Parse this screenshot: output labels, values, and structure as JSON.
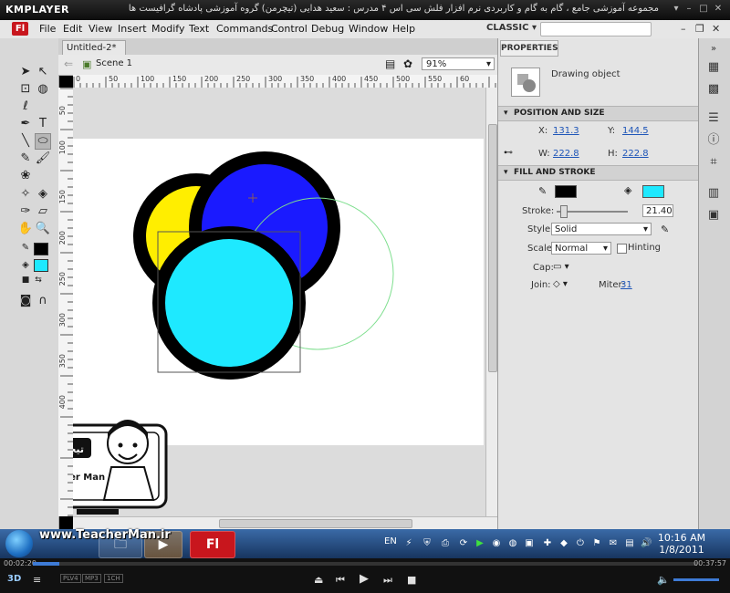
{
  "player": {
    "logo": "KMPLAYER",
    "title": "مجموعه آموزشی جامع ، گام به گام و کاربردی نرم افزار فلش سی اس ۴ مدرس : سعید هدایی (تیچرمن) گروه آموزشی پادشاه گرافیست ها",
    "elapsed": "00:02:20",
    "total": "00:37:57",
    "progress_fraction": 0.04,
    "badges": [
      "PLV4",
      "MP3",
      "1CH"
    ]
  },
  "menu": {
    "app_logo": "Fl",
    "items": [
      "File",
      "Edit",
      "View",
      "Insert",
      "Modify",
      "Text",
      "Commands",
      "Control",
      "Debug",
      "Window",
      "Help"
    ],
    "workspace": "CLASSIC"
  },
  "document": {
    "tab": "Untitled-2*",
    "scene": "Scene 1",
    "zoom": "91%"
  },
  "ruler": {
    "top_labels": [
      "0",
      "50",
      "100",
      "150",
      "200",
      "250",
      "300",
      "350",
      "400",
      "450",
      "500",
      "550",
      "60"
    ],
    "left_labels": [
      "50",
      "100",
      "150",
      "200",
      "250",
      "300",
      "350",
      "400"
    ]
  },
  "stage": {
    "colors": {
      "yellow": "#ffee00",
      "blue": "#1a1aff",
      "cyan": "#1ee9ff",
      "stroke": "#000000",
      "selection_outline": "#7fdf8f"
    }
  },
  "properties": {
    "tab": "PROPERTIES",
    "object": "Drawing object",
    "position_section": "POSITION AND SIZE",
    "x_label": "X:",
    "x": "131.3",
    "y_label": "Y:",
    "y": "144.5",
    "w_label": "W:",
    "w": "222.8",
    "h_label": "H:",
    "h": "222.8",
    "fill_section": "FILL AND STROKE",
    "stroke_color": "#000000",
    "fill_color": "#1ee9ff",
    "stroke_label": "Stroke:",
    "stroke": "21.40",
    "style_label": "Style:",
    "style": "Solid",
    "scale_label": "Scale:",
    "scale": "Normal",
    "hinting": "Hinting",
    "cap_label": "Cap:",
    "join_label": "Join:",
    "miter_label": "Miter:",
    "miter": "31"
  },
  "taskbar": {
    "lang": "EN",
    "time": "10:16 AM",
    "date": "1/8/2011",
    "active_app": "Fl"
  },
  "watermark": {
    "url": "www.TeacherMan.ir",
    "name": "Teacher Man",
    "logo_text": "تیچرمن"
  }
}
